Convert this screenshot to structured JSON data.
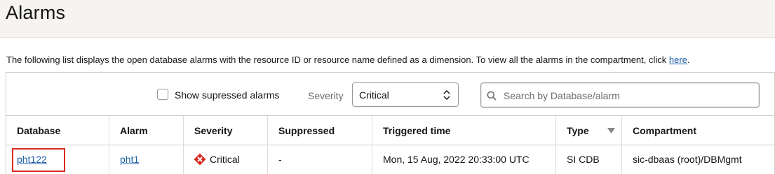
{
  "page": {
    "title": "Alarms"
  },
  "description": {
    "text": "The following list displays the open database alarms with the resource ID or resource name defined as a dimension. To view all the alarms in the compartment, click ",
    "link": "here",
    "suffix": "."
  },
  "filters": {
    "suppressed_label": "Show supressed alarms",
    "suppressed_checked": false,
    "severity_label": "Severity",
    "severity_value": "Critical",
    "search_placeholder": "Search by Database/alarm"
  },
  "table": {
    "columns": [
      "Database",
      "Alarm",
      "Severity",
      "Suppressed",
      "Triggered time",
      "Type",
      "Compartment"
    ],
    "rows": [
      {
        "database": "pht122",
        "alarm": "pht1",
        "severity": "Critical",
        "suppressed": "-",
        "triggered_time": "Mon, 15 Aug, 2022 20:33:00 UTC",
        "type": "SI CDB",
        "compartment": "sic-dbaas (root)/DBMgmt"
      }
    ]
  },
  "colors": {
    "link": "#1f5fa8",
    "critical": "#d92a21",
    "highlight_box": "#d92a21",
    "header_bg": "#f5f4f2"
  },
  "icons": {
    "severity": "critical-x-diamond-icon",
    "search": "magnifier-icon",
    "select": "up-down-caret-icon",
    "sort": "sort-down-triangle-icon"
  }
}
